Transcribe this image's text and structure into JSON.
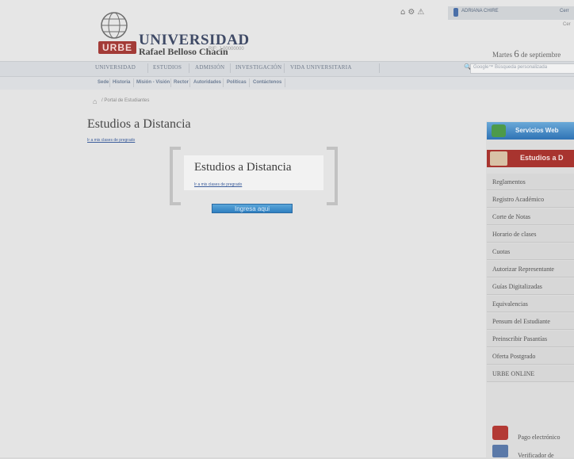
{
  "header": {
    "logo_title": "UNIVERSIDAD",
    "logo_subtitle": "Rafael Belloso Chacín",
    "logo_tag": "RIF: J-00000000",
    "logo_mark": "URBE",
    "user_name": "ADRIANA CHIRE",
    "user_link": "Cerr",
    "user_link2": "Cer",
    "date_prefix": "Martes",
    "date_day": "6",
    "date_suffix": "de septiembre"
  },
  "nav": {
    "items": [
      "UNIVERSIDAD",
      "ESTUDIOS",
      "ADMISIÓN",
      "INVESTIGACIÓN",
      "VIDA UNIVERSITARIA"
    ],
    "search_placeholder": "Google™ Búsqueda personalizada"
  },
  "subnav": {
    "items": [
      "Sede",
      "Historia",
      "Misión - Visión",
      "Rector",
      "Autoridades",
      "Políticas",
      "Contáctenos"
    ]
  },
  "breadcrumb": "/ Portal de Estudiantes",
  "main": {
    "title": "Estudios a Distancia",
    "link": "Ir a mis clases de pregrado",
    "card_title": "Estudios a Distancia",
    "card_link": "Ir a mis clases de pregrado",
    "button": "Ingresa aqui"
  },
  "sidebar": {
    "servicios": "Servicios Web",
    "estudios": "Estudios a D",
    "items": [
      "Reglamentos",
      "Registro Académico",
      "Corte de Notas",
      "Horario de clases",
      "Cuotas",
      "Autorizar Representante",
      "Guías Digitalizadas",
      "Equivalencias",
      "Pensum del Estudiante",
      "Preinscribir Pasantías",
      "Oferta Postgrado",
      "URBE ONLINE"
    ],
    "pago": "Pago electrónico",
    "verificador": "Verificador de"
  }
}
